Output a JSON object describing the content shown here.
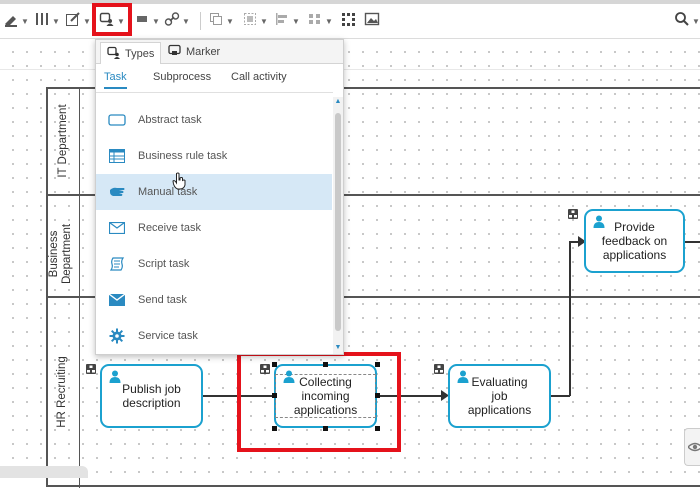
{
  "toolbar": {
    "items": [
      {
        "name": "highlighter-tool-icon"
      },
      {
        "name": "columns-tool-icon"
      },
      {
        "name": "edit-tool-icon"
      },
      {
        "name": "insert-task-tool-icon"
      },
      {
        "name": "shape-tool-icon"
      },
      {
        "name": "link-tool-icon"
      },
      {
        "name": "copy-format-icon"
      },
      {
        "name": "select-all-icon"
      },
      {
        "name": "align-icon"
      },
      {
        "name": "distribute-icon"
      },
      {
        "name": "grid-icon"
      },
      {
        "name": "image-icon"
      },
      {
        "name": "search-icon"
      }
    ],
    "highlight_color": "#e5121b"
  },
  "panel": {
    "tabs": [
      {
        "label": "Types",
        "icon": "task-types-icon",
        "active": true
      },
      {
        "label": "Marker",
        "icon": "marker-icon",
        "active": false
      }
    ],
    "subtabs": [
      {
        "label": "Task",
        "active": true
      },
      {
        "label": "Subprocess",
        "active": false
      },
      {
        "label": "Call activity",
        "active": false
      }
    ],
    "items": [
      {
        "label": "Abstract task",
        "icon": "abstract-task-icon"
      },
      {
        "label": "Business rule task",
        "icon": "business-rule-task-icon"
      },
      {
        "label": "Manual task",
        "icon": "manual-task-icon",
        "hovered": true
      },
      {
        "label": "Receive task",
        "icon": "receive-task-icon"
      },
      {
        "label": "Script task",
        "icon": "script-task-icon"
      },
      {
        "label": "Send task",
        "icon": "send-task-icon"
      },
      {
        "label": "Service task",
        "icon": "service-task-icon"
      }
    ],
    "accent": "#2a8ac1"
  },
  "lanes": [
    {
      "label": "IT Department"
    },
    {
      "label": "Business Department"
    },
    {
      "label": "HR Recruiting"
    }
  ],
  "tasks": [
    {
      "label": "Provide feedback on applications",
      "icon": "user-task-icon"
    },
    {
      "label": "Publish job description",
      "icon": "user-task-icon"
    },
    {
      "label": "Collecting incoming applications",
      "icon": "user-task-icon",
      "selected": true
    },
    {
      "label": "Evaluating job applications",
      "icon": "user-task-icon"
    }
  ],
  "colors": {
    "task_border": "#1ba1cf",
    "lane_border": "#555555"
  }
}
